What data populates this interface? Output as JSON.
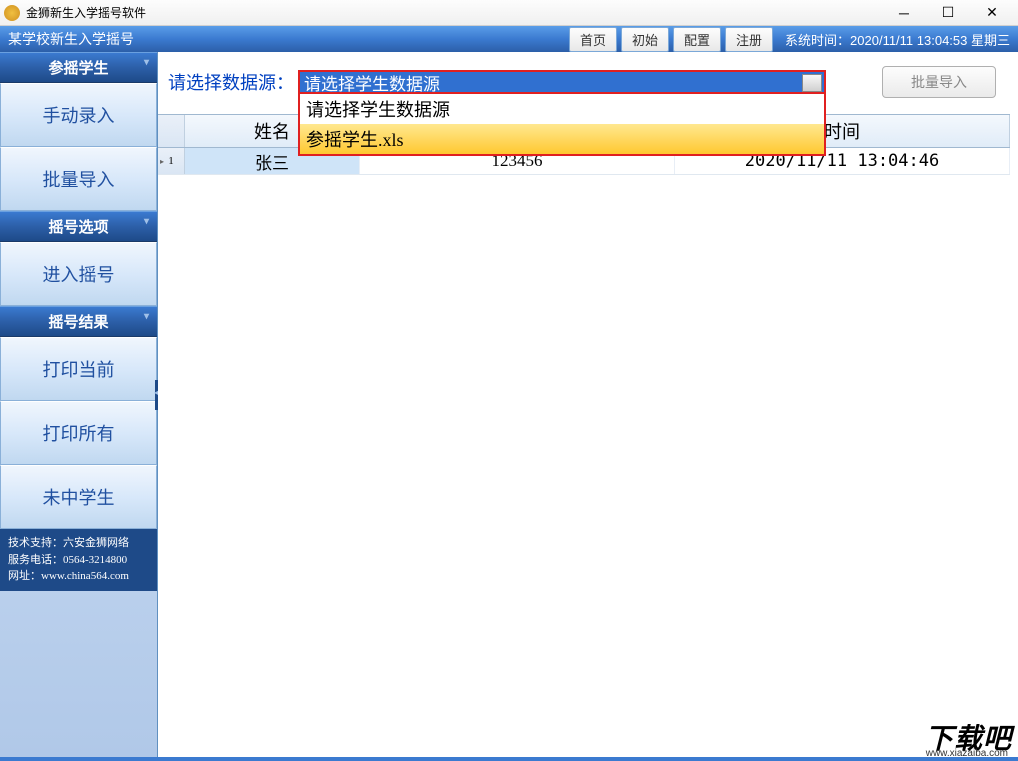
{
  "titlebar": {
    "text": "金狮新生入学摇号软件"
  },
  "header": {
    "title": "某学校新生入学摇号",
    "buttons": {
      "home": "首页",
      "init": "初始",
      "config": "配置",
      "register": "注册"
    },
    "systime_label": "系统时间：",
    "systime_value": "2020/11/11 13:04:53 星期三"
  },
  "sidebar": {
    "group1_header": "参摇学生",
    "btn_manual": "手动录入",
    "btn_batch": "批量导入",
    "group2_header": "摇号选项",
    "btn_enter": "进入摇号",
    "group3_header": "摇号结果",
    "btn_print_cur": "打印当前",
    "btn_print_all": "打印所有",
    "btn_not_win": "未中学生",
    "info_support": "技术支持：六安金狮网络",
    "info_phone": "服务电话：0564-3214800",
    "info_site": "网址：www.china564.com"
  },
  "datasource": {
    "label": "请选择数据源：",
    "selected": "请选择学生数据源",
    "options": [
      "请选择学生数据源",
      "参摇学生.xls"
    ],
    "import_btn": "批量导入"
  },
  "table": {
    "cols": {
      "name": "姓名",
      "time": "时间"
    },
    "rows": [
      {
        "num": "1",
        "name": "张三",
        "id": "123456",
        "time": "2020/11/11 13:04:46"
      }
    ]
  },
  "watermark": {
    "big": "下载吧",
    "url": "www.xiazaiba.com"
  }
}
